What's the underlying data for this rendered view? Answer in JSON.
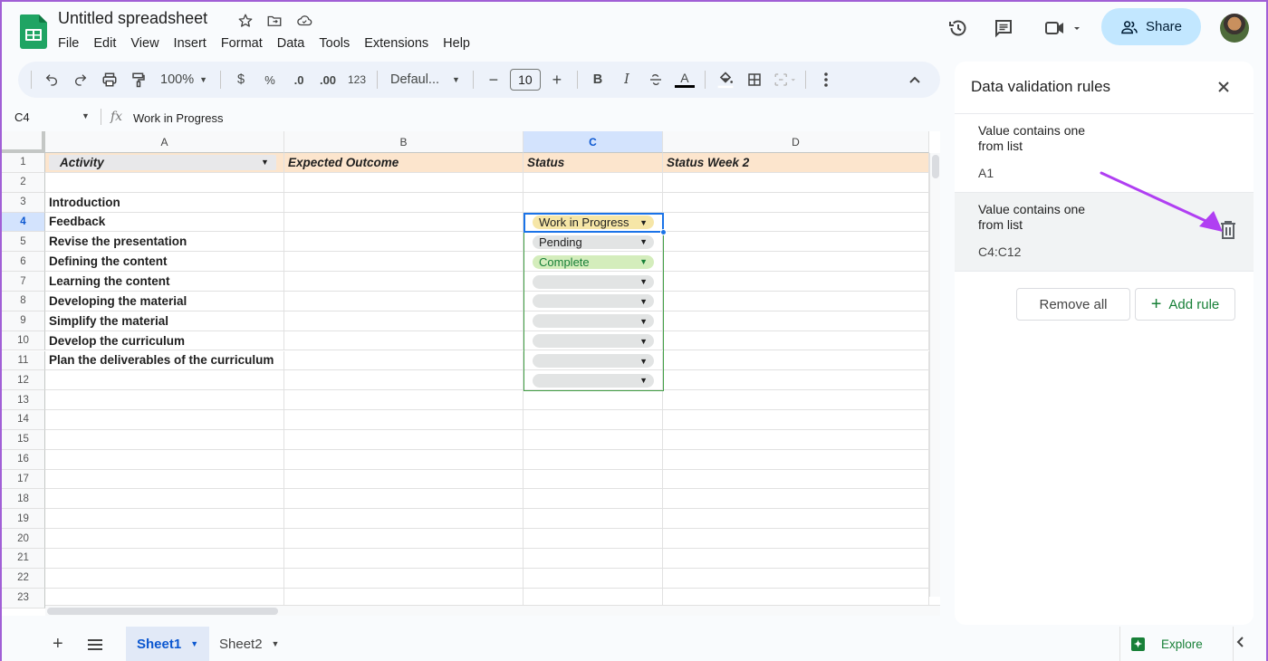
{
  "app": {
    "title": "Untitled spreadsheet",
    "menu": [
      "File",
      "Edit",
      "View",
      "Insert",
      "Format",
      "Data",
      "Tools",
      "Extensions",
      "Help"
    ],
    "share_label": "Share",
    "icons": {
      "star": "star-icon",
      "move": "move-to-folder-icon",
      "cloud": "cloud-saved-icon",
      "history": "version-history-icon",
      "comments": "comments-icon",
      "meet": "video-call-icon"
    }
  },
  "toolbar": {
    "zoom": "100%",
    "currency": "$",
    "percent": "%",
    "decrease_decimal": ".0",
    "increase_decimal": ".00",
    "number_format": "123",
    "font": "Defaul...",
    "font_size": "10",
    "minus": "−",
    "plus": "+",
    "bold": "B",
    "italic": "I",
    "text_color": "A"
  },
  "formula_bar": {
    "cell_ref": "C4",
    "fx": "fx",
    "value": "Work in Progress"
  },
  "grid": {
    "columns": [
      "A",
      "B",
      "C",
      "D"
    ],
    "selected_column": "C",
    "selected_row": 4,
    "rows": [
      "1",
      "2",
      "3",
      "4",
      "5",
      "6",
      "7",
      "8",
      "9",
      "10",
      "11",
      "12",
      "13",
      "14",
      "15",
      "16",
      "17",
      "18",
      "19",
      "20",
      "21",
      "22",
      "23"
    ],
    "header_row": {
      "A": "Activity",
      "B": "Expected Outcome",
      "C": "Status",
      "D": "Status Week 2"
    },
    "column_a": {
      "3": "Introduction",
      "4": "Feedback",
      "5": "Revise the presentation",
      "6": "Defining the content",
      "7": "Learning the content",
      "8": "Developing the material",
      "9": "Simplify the material",
      "10": "Develop the curriculum",
      "11": "Plan the deliverables of the curriculum"
    },
    "status_chips": [
      {
        "row": 4,
        "value": "Work in Progress",
        "bg": "#f6e6a7",
        "fg": "#1f1f1f"
      },
      {
        "row": 5,
        "value": "Pending",
        "bg": "#e2e4e4",
        "fg": "#1f1f1f"
      },
      {
        "row": 6,
        "value": "Complete",
        "bg": "#d4edbc",
        "fg": "#188038"
      },
      {
        "row": 7,
        "value": "",
        "bg": "#e2e4e4",
        "fg": "#1f1f1f"
      },
      {
        "row": 8,
        "value": "",
        "bg": "#e2e4e4",
        "fg": "#1f1f1f"
      },
      {
        "row": 9,
        "value": "",
        "bg": "#e2e4e4",
        "fg": "#1f1f1f"
      },
      {
        "row": 10,
        "value": "",
        "bg": "#e2e4e4",
        "fg": "#1f1f1f"
      },
      {
        "row": 11,
        "value": "",
        "bg": "#e2e4e4",
        "fg": "#1f1f1f"
      },
      {
        "row": 12,
        "value": "",
        "bg": "#e2e4e4",
        "fg": "#1f1f1f"
      }
    ]
  },
  "sidebar": {
    "title": "Data validation rules",
    "rules": [
      {
        "condition": "Value contains one from list",
        "range": "A1"
      },
      {
        "condition": "Value contains one from list",
        "range": "C4:C12"
      }
    ],
    "remove_all_label": "Remove all",
    "add_rule_label": "Add rule",
    "annotation_color": "#b03ff2"
  },
  "bottom": {
    "sheets": [
      "Sheet1",
      "Sheet2"
    ],
    "active_sheet": "Sheet1",
    "explore_label": "Explore"
  },
  "colors": {
    "accent": "#0b57d0",
    "share_bg": "#c2e7ff",
    "header_fill": "#fce5cd",
    "green": "#188038"
  }
}
